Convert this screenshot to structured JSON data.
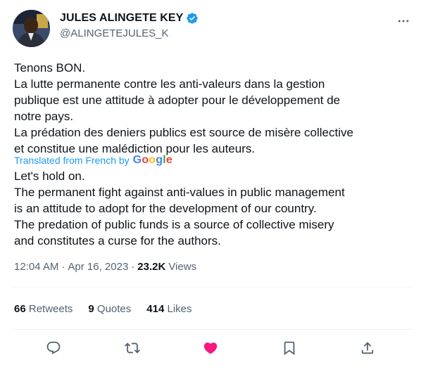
{
  "author": {
    "display_name": "JULES ALINGETE KEY",
    "handle": "@ALINGETEJULES_K",
    "verified": true
  },
  "tweet": {
    "original_lines": [
      "Tenons BON.",
      "La lutte permanente contre les anti-valeurs dans la gestion",
      "publique est une attitude à adopter pour le développement de",
      "notre pays.",
      "La prédation des deniers publics est source de misère collective",
      "et constitue une malédiction pour les auteurs."
    ],
    "translated_from_label": "Translated from French by",
    "translator_brand": "Google",
    "translation_lines": [
      "Let's hold on.",
      "The permanent fight against anti-values in public management",
      "is an attitude to adopt for the development of our country.",
      "The predation of public funds is a source of collective misery",
      "and constitutes a curse for the authors."
    ]
  },
  "meta": {
    "time": "12:04 AM",
    "separator": "·",
    "date": "Apr 16, 2023",
    "views_count": "23.2K",
    "views_label": "Views"
  },
  "stats": {
    "retweets_count": "66",
    "retweets_label": "Retweets",
    "quotes_count": "9",
    "quotes_label": "Quotes",
    "likes_count": "414",
    "likes_label": "Likes"
  },
  "actions": [
    {
      "name": "reply-icon"
    },
    {
      "name": "retweet-icon"
    },
    {
      "name": "like-icon",
      "active": true
    },
    {
      "name": "bookmark-icon"
    },
    {
      "name": "share-icon"
    }
  ],
  "colors": {
    "text": "#0f1419",
    "secondary": "#536471",
    "link_blue": "#1d9bf0",
    "like_pink": "#f91880",
    "divider": "#eff3f4"
  }
}
